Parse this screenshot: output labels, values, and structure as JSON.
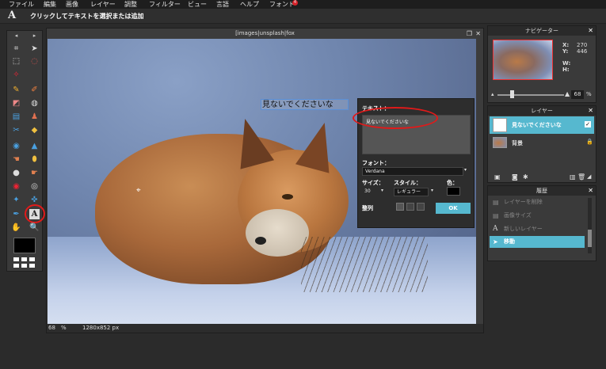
{
  "menu": {
    "items": [
      "ファイル",
      "編集",
      "画像",
      "レイヤー",
      "調整",
      "フィルター",
      "ビュー",
      "言語",
      "ヘルプ",
      "フォント"
    ],
    "font_badge": "4"
  },
  "options_bar": {
    "logo": "A",
    "hint": "クリックしてテキストを選択または追加"
  },
  "canvas": {
    "title": "[images|unsplash|fox",
    "zoom": "68",
    "zoom_unit": "%",
    "dimensions": "1280x852 px",
    "typed_text": "見ないでくださいな"
  },
  "text_dialog": {
    "text_label": "テキスト：",
    "text_value": "見ないでくださいな",
    "font_label": "フォント：",
    "font_value": "Verdana",
    "size_label": "サイズ：",
    "size_value": "30",
    "style_label": "スタイル：",
    "style_value": "レギュラー",
    "color_label": "色：",
    "color_value": "#000000",
    "align_label": "整列",
    "ok_label": "OK"
  },
  "navigator": {
    "title": "ナビゲーター",
    "x_label": "X:",
    "x_value": "270",
    "y_label": "Y:",
    "y_value": "446",
    "w_label": "W:",
    "h_label": "H:",
    "zoom_value": "68",
    "zoom_unit": "%"
  },
  "layers": {
    "title": "レイヤー",
    "items": [
      {
        "name": "見ないでくださいな",
        "selected": true,
        "visible": true
      },
      {
        "name": "背景",
        "selected": false,
        "locked": true
      }
    ]
  },
  "history": {
    "title": "履歴",
    "items": [
      {
        "label": "レイヤーを削除",
        "dimmed": true
      },
      {
        "label": "画像サイズ",
        "dimmed": true
      },
      {
        "label": "新しいレイヤー",
        "dimmed": true
      },
      {
        "label": "移動",
        "dimmed": false,
        "selected": true
      }
    ]
  },
  "colors": {
    "accent": "#56b8cf",
    "highlight_ring": "#e01a1a",
    "foreground": "#000000"
  }
}
